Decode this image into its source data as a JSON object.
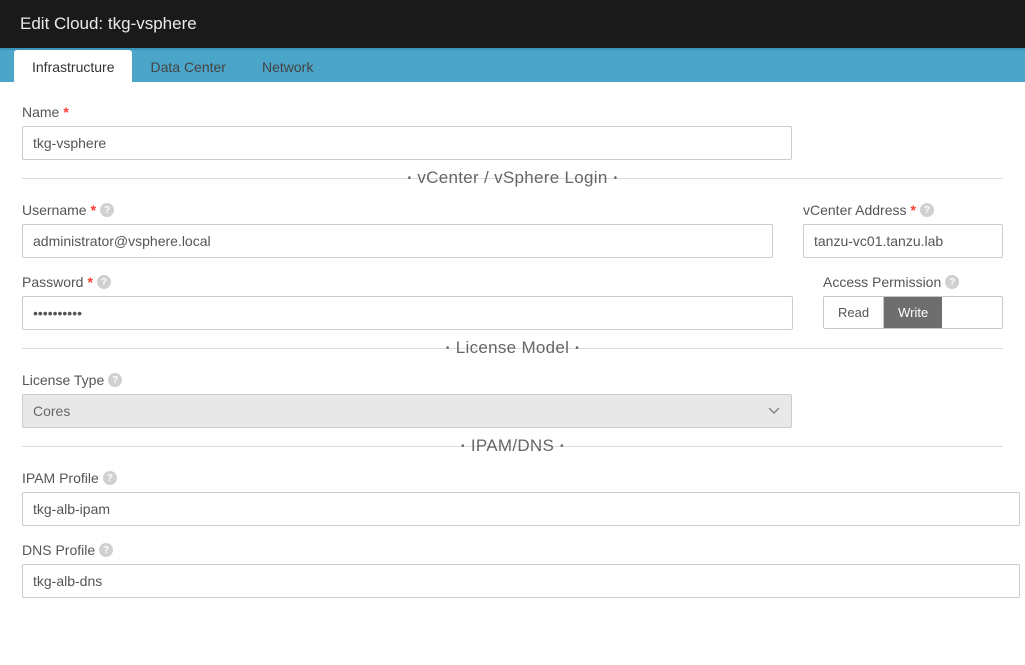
{
  "header": {
    "title_prefix": "Edit Cloud: ",
    "cloud_name": "tkg-vsphere"
  },
  "tabs": [
    {
      "label": "Infrastructure",
      "active": true
    },
    {
      "label": "Data Center",
      "active": false
    },
    {
      "label": "Network",
      "active": false
    }
  ],
  "form": {
    "name_label": "Name",
    "name_value": "tkg-vsphere"
  },
  "sections": {
    "login": "vCenter / vSphere Login",
    "license": "License Model",
    "ipam": "IPAM/DNS"
  },
  "login": {
    "username_label": "Username",
    "username_value": "administrator@vsphere.local",
    "password_label": "Password",
    "password_value": "••••••••••",
    "vcenter_address_label": "vCenter Address",
    "vcenter_address_value": "tanzu-vc01.tanzu.lab",
    "access_permission_label": "Access Permission",
    "access_read": "Read",
    "access_write": "Write"
  },
  "license": {
    "type_label": "License Type",
    "type_value": "Cores"
  },
  "ipam": {
    "ipam_profile_label": "IPAM Profile",
    "ipam_profile_value": "tkg-alb-ipam",
    "dns_profile_label": "DNS Profile",
    "dns_profile_value": "tkg-alb-dns"
  }
}
